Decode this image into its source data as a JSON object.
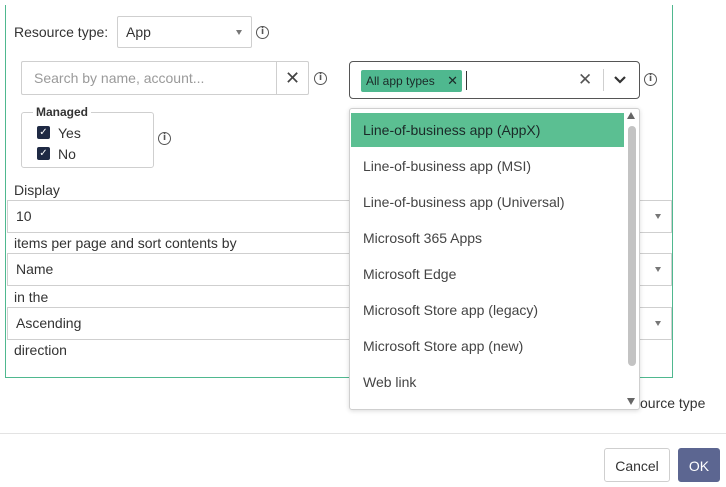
{
  "resource": {
    "label": "Resource type:",
    "value": "App"
  },
  "search": {
    "placeholder": "Search by name, account..."
  },
  "managed": {
    "legend": "Managed",
    "options": [
      {
        "label": "Yes",
        "checked": true
      },
      {
        "label": "No",
        "checked": true
      }
    ]
  },
  "display": {
    "label": "Display",
    "per_page_value": "10",
    "sort_label": "items per page and sort contents by",
    "sort_value": "Name",
    "in_the_label": "in the",
    "direction_value": "Ascending",
    "direction_label": "direction"
  },
  "app_types": {
    "chip": "All app types",
    "options": [
      "Line-of-business app (AppX)",
      "Line-of-business app (MSI)",
      "Line-of-business app (Universal)",
      "Microsoft 365 Apps",
      "Microsoft Edge",
      "Microsoft Store app (legacy)",
      "Microsoft Store app (new)",
      "Web link"
    ],
    "highlighted_index": 0
  },
  "background": {
    "partial_text": "ource type"
  },
  "footer": {
    "cancel": "Cancel",
    "ok": "OK"
  },
  "colors": {
    "accent": "#4fb88f",
    "highlight": "#5bbf92",
    "primary_button": "#5c6691",
    "checkbox": "#1f2a44"
  },
  "icons": {
    "info": "info-icon",
    "clear": "close-icon",
    "dropdown": "chevron-down-icon"
  }
}
